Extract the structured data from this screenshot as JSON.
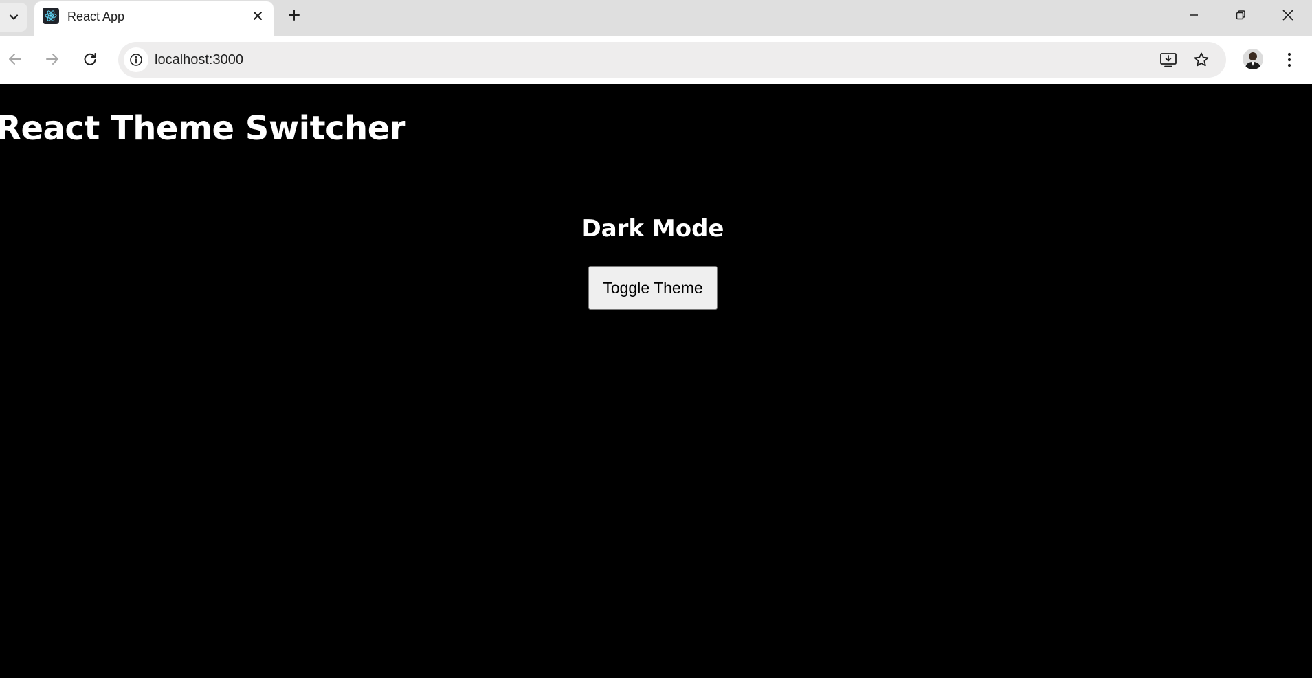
{
  "browser": {
    "tab": {
      "title": "React App",
      "favicon": "react-logo-icon"
    },
    "address_bar": {
      "url": "localhost:3000"
    },
    "icons": {
      "tab_search": "chevron-down-icon",
      "tab_close": "close-icon",
      "new_tab": "plus-icon",
      "back": "arrow-left-icon",
      "forward": "arrow-right-icon",
      "reload": "reload-icon",
      "site_info": "info-icon",
      "install": "install-app-icon",
      "bookmark": "star-icon",
      "menu": "kebab-menu-icon",
      "minimize": "minimize-icon",
      "restore": "restore-icon",
      "close_window": "close-icon"
    }
  },
  "page": {
    "heading": "React Theme Switcher",
    "mode_label": "Dark Mode",
    "toggle_button_label": "Toggle Theme",
    "background_color": "#000000",
    "text_color": "#ffffff"
  }
}
